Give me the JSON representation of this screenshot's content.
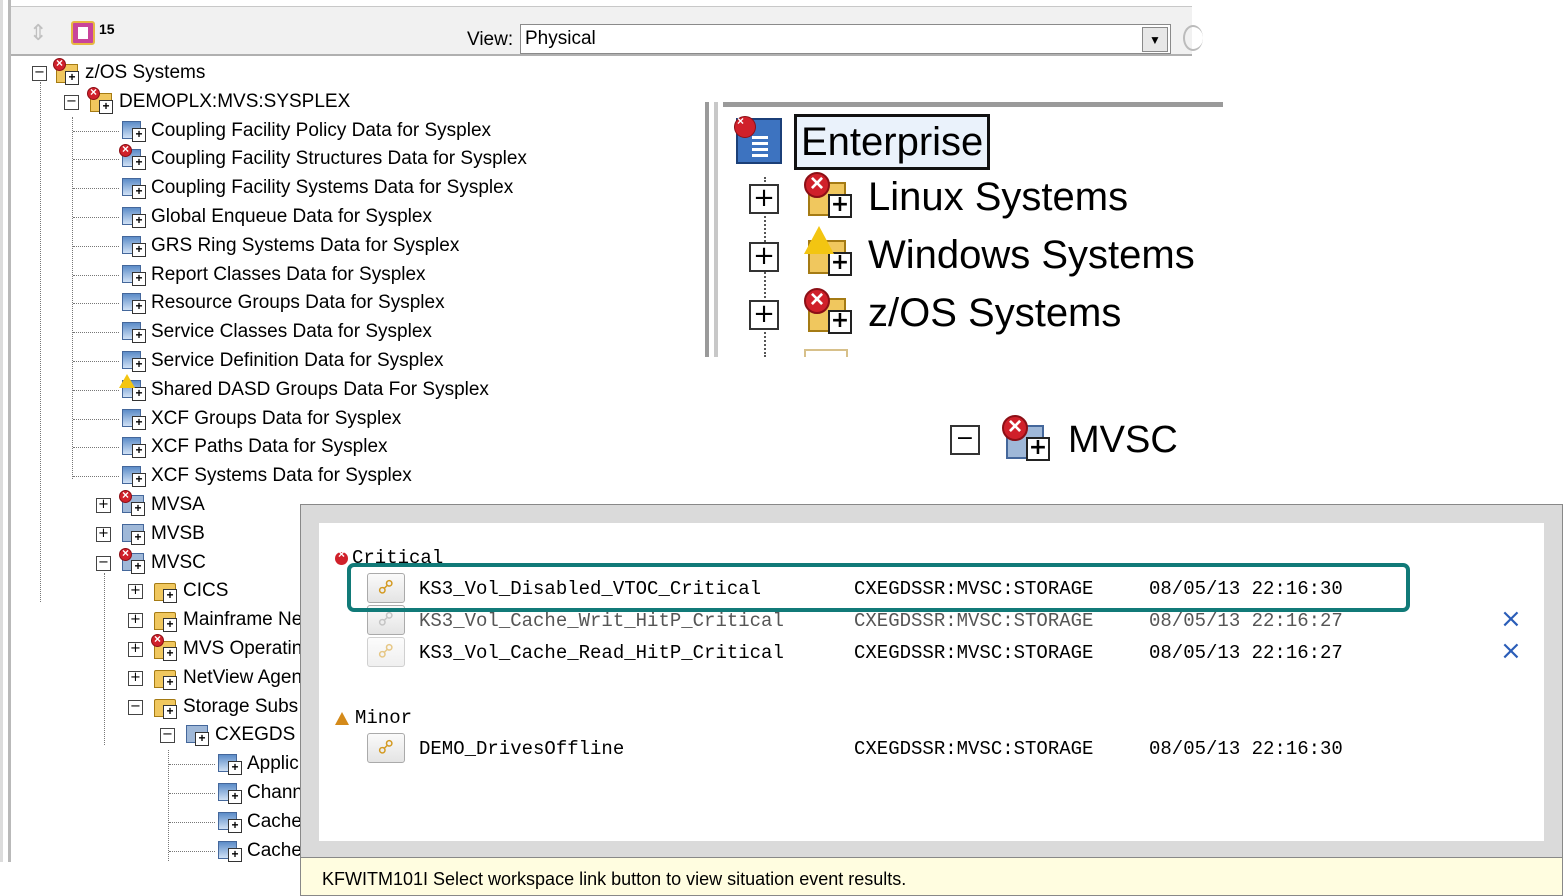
{
  "toolbar": {
    "count": "15",
    "view_label": "View:",
    "view_value": "Physical"
  },
  "tree": {
    "root": "z/OS Systems",
    "sysplex": "DEMOPLX:MVS:SYSPLEX",
    "sysplex_items": [
      "Coupling Facility Policy Data for Sysplex",
      "Coupling Facility Structures Data for Sysplex",
      "Coupling Facility Systems Data for Sysplex",
      "Global Enqueue Data for Sysplex",
      "GRS Ring Systems Data for Sysplex",
      "Report Classes Data for Sysplex",
      "Resource Groups Data for Sysplex",
      "Service Classes Data for Sysplex",
      "Service Definition Data for Sysplex",
      "Shared DASD Groups Data For Sysplex",
      "XCF Groups Data for Sysplex",
      "XCF Paths Data for Sysplex",
      "XCF Systems Data for Sysplex"
    ],
    "mvsa": "MVSA",
    "mvsb": "MVSB",
    "mvsc": "MVSC",
    "mvsc_items": [
      "CICS",
      "Mainframe Ne",
      "MVS Operatin",
      "NetView Agen",
      "Storage Subs"
    ],
    "storage_child": "CXEGDS",
    "storage_items": [
      "Applic",
      "Chann",
      "Cache",
      "Cache"
    ]
  },
  "zoom_enterprise": {
    "title": "Enterprise",
    "items": [
      "Linux Systems",
      "Windows Systems",
      "z/OS Systems"
    ]
  },
  "zoom_mvsc": {
    "label": "MVSC"
  },
  "popup": {
    "critical_label": "Critical",
    "minor_label": "Minor",
    "critical_events": [
      {
        "name": "KS3_Vol_Disabled_VTOC_Critical",
        "source": "CXEGDSSR:MVSC:STORAGE",
        "time": "08/05/13 22:16:30"
      },
      {
        "name": "KS3_Vol_Cache_Writ_HitP_Critical",
        "source": "CXEGDSSR:MVSC:STORAGE",
        "time": "08/05/13 22:16:27"
      },
      {
        "name": "KS3_Vol_Cache_Read_HitP_Critical",
        "source": "CXEGDSSR:MVSC:STORAGE",
        "time": "08/05/13 22:16:27"
      }
    ],
    "minor_events": [
      {
        "name": "DEMO_DrivesOffline",
        "source": "CXEGDSSR:MVSC:STORAGE",
        "time": "08/05/13 22:16:30"
      }
    ],
    "close_glyph": "×",
    "status": "KFWITM101I Select workspace link button to view situation event results."
  },
  "colors": {
    "critical": "#d0202a",
    "warning": "#f3c511",
    "highlight": "#117a78",
    "status_bg": "#fffde0"
  },
  "icons": [
    "navigate-icon",
    "situation-count-icon",
    "dropdown-icon",
    "workspace-icon",
    "folder-icon",
    "system-icon",
    "critical-icon",
    "warning-icon",
    "link-icon",
    "close-icon",
    "enterprise-icon"
  ]
}
